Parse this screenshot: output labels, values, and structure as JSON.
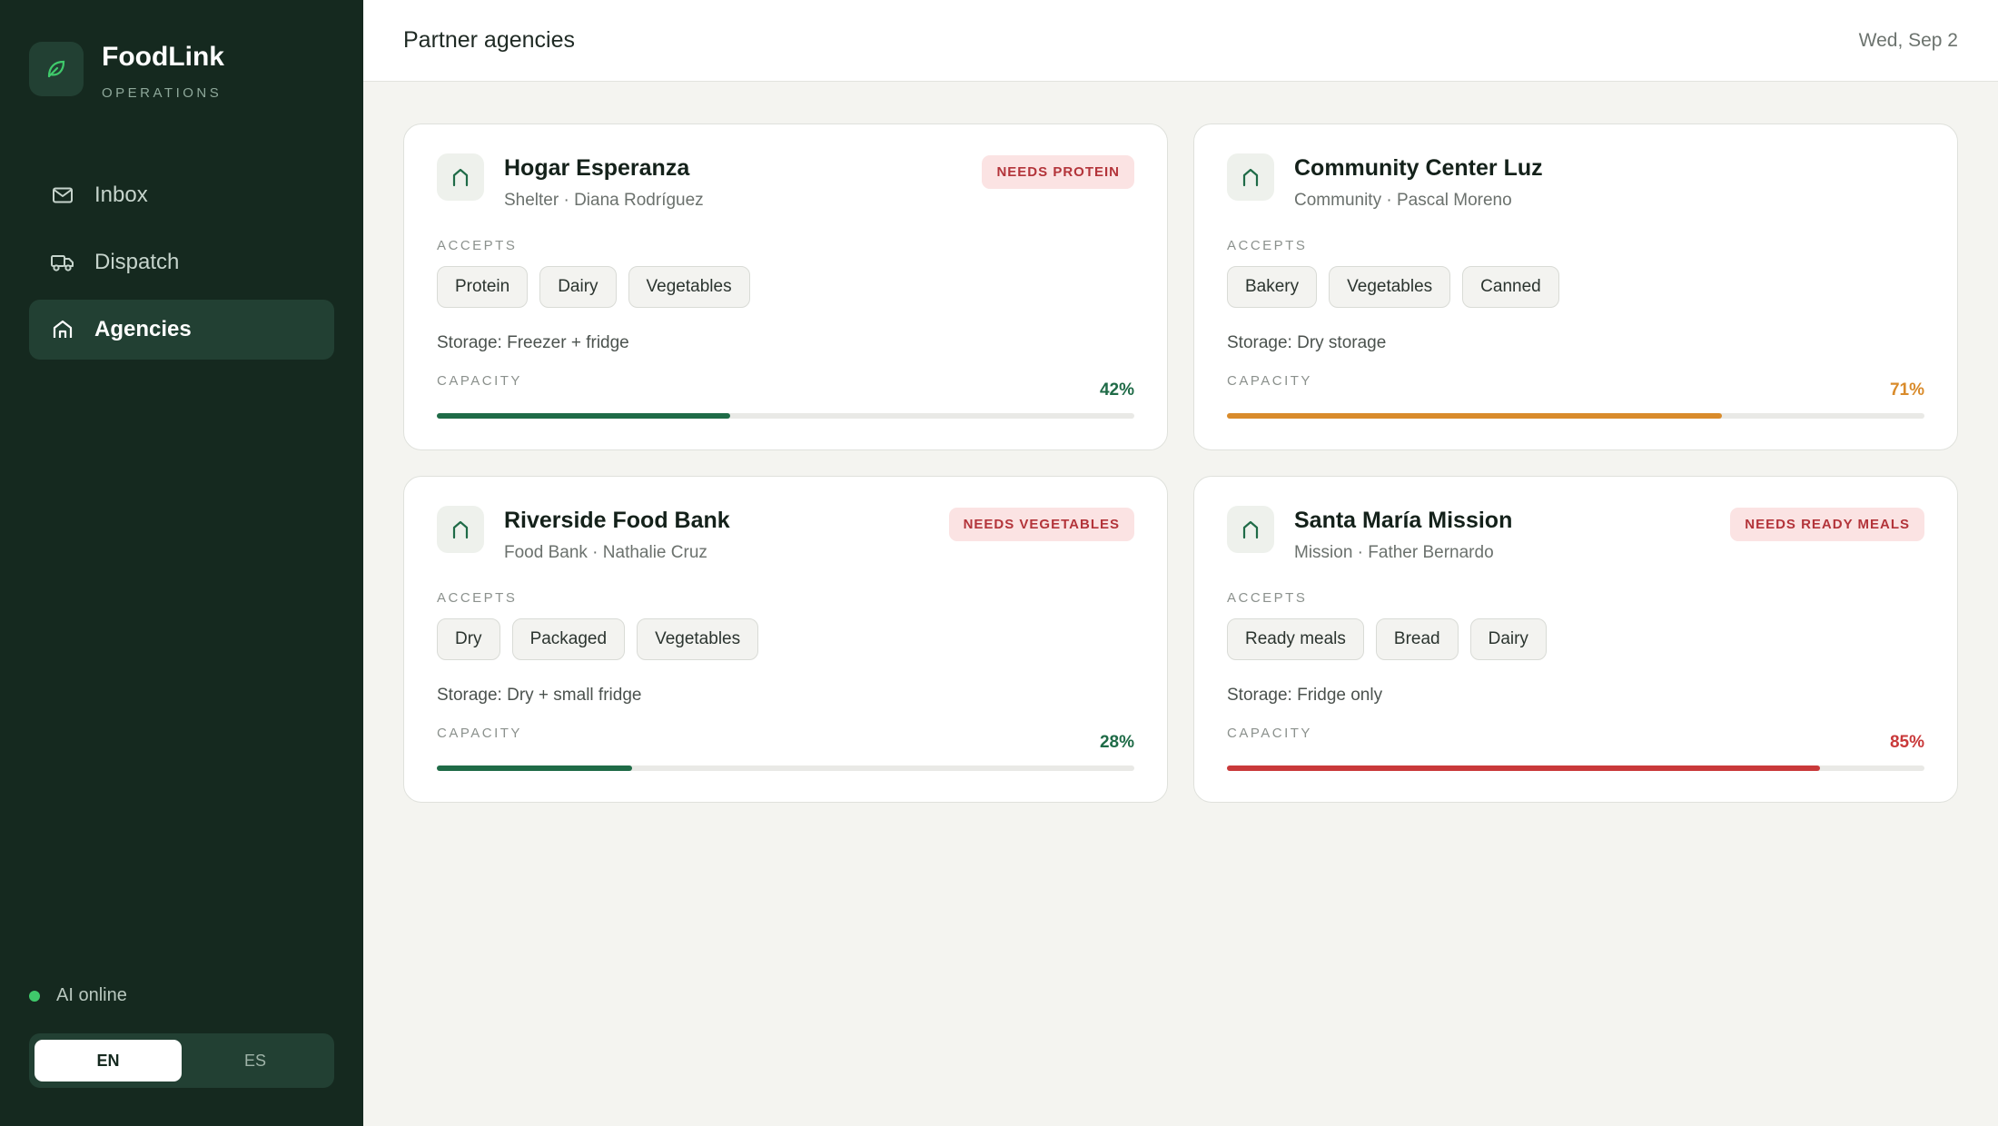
{
  "brand": {
    "name": "FoodLink",
    "subtitle": "OPERATIONS"
  },
  "nav": [
    {
      "label": "Inbox",
      "icon": "mail-icon",
      "active": false
    },
    {
      "label": "Dispatch",
      "icon": "truck-icon",
      "active": false
    },
    {
      "label": "Agencies",
      "icon": "home-icon",
      "active": true
    }
  ],
  "status": {
    "label": "AI online",
    "color": "#3fca6b"
  },
  "language": {
    "options": [
      "EN",
      "ES"
    ],
    "selected": "EN"
  },
  "header": {
    "title": "Partner agencies",
    "date": "Wed, Sep 2"
  },
  "labels": {
    "accepts": "ACCEPTS",
    "capacity": "CAPACITY"
  },
  "agencies": [
    {
      "name": "Hogar Esperanza",
      "meta": "Shelter · Diana Rodríguez",
      "badge": "NEEDS PROTEIN",
      "accepts": [
        "Protein",
        "Dairy",
        "Vegetables"
      ],
      "storage": "Storage: Freezer + fridge",
      "capacity_label": "42%",
      "capacity": 0.42,
      "capacity_color": "#1f6b47"
    },
    {
      "name": "Community Center Luz",
      "meta": "Community · Pascal Moreno",
      "badge": "",
      "accepts": [
        "Bakery",
        "Vegetables",
        "Canned"
      ],
      "storage": "Storage: Dry storage",
      "capacity_label": "71%",
      "capacity": 0.71,
      "capacity_color": "#d98b2b"
    },
    {
      "name": "Riverside Food Bank",
      "meta": "Food Bank · Nathalie Cruz",
      "badge": "NEEDS VEGETABLES",
      "accepts": [
        "Dry",
        "Packaged",
        "Vegetables"
      ],
      "storage": "Storage: Dry + small fridge",
      "capacity_label": "28%",
      "capacity": 0.28,
      "capacity_color": "#1f6b47"
    },
    {
      "name": "Santa María Mission",
      "meta": "Mission · Father Bernardo",
      "badge": "NEEDS READY MEALS",
      "accepts": [
        "Ready meals",
        "Bread",
        "Dairy"
      ],
      "storage": "Storage: Fridge only",
      "capacity_label": "85%",
      "capacity": 0.85,
      "capacity_color": "#c9393a"
    }
  ],
  "colors": {
    "sidebar_bg": "#15291f",
    "accent_green": "#1f6b47",
    "warning_orange": "#d98b2b",
    "danger_red": "#c9393a",
    "badge_bg": "#fbe3e3",
    "badge_text": "#b3343a"
  }
}
